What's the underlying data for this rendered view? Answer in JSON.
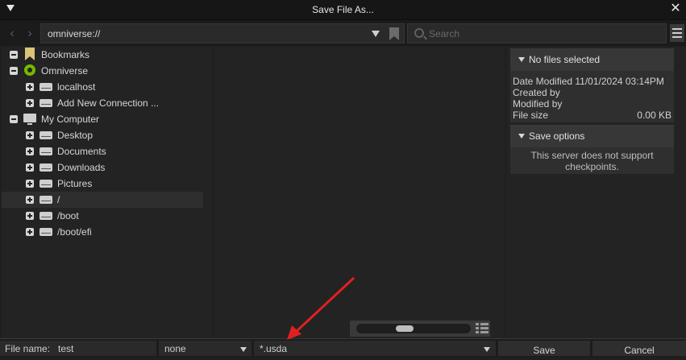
{
  "window": {
    "title": "Save File As..."
  },
  "toolbar": {
    "back_icon": "chevron-left-icon",
    "forward_icon": "chevron-right-icon",
    "path": "omniverse://",
    "search_placeholder": "Search"
  },
  "tree": [
    {
      "label": "Bookmarks",
      "icon": "bookmark-icon",
      "toggle": "minus",
      "level": 0
    },
    {
      "label": "Omniverse",
      "icon": "omniverse-icon",
      "toggle": "minus",
      "level": 0
    },
    {
      "label": "localhost",
      "icon": "server-icon",
      "toggle": "plus",
      "level": 1
    },
    {
      "label": "Add New Connection ...",
      "icon": "add-connection-icon",
      "toggle": "plus",
      "level": 1
    },
    {
      "label": "My Computer",
      "icon": "monitor-icon",
      "toggle": "minus",
      "level": 0
    },
    {
      "label": "Desktop",
      "icon": "drive-icon",
      "toggle": "plus",
      "level": 1
    },
    {
      "label": "Documents",
      "icon": "drive-icon",
      "toggle": "plus",
      "level": 1
    },
    {
      "label": "Downloads",
      "icon": "drive-icon",
      "toggle": "plus",
      "level": 1
    },
    {
      "label": "Pictures",
      "icon": "drive-icon",
      "toggle": "plus",
      "level": 1
    },
    {
      "label": "/",
      "icon": "drive-icon",
      "toggle": "plus",
      "level": 1,
      "selected": true
    },
    {
      "label": "/boot",
      "icon": "drive-icon",
      "toggle": "plus",
      "level": 1
    },
    {
      "label": "/boot/efi",
      "icon": "drive-icon",
      "toggle": "plus",
      "level": 1
    }
  ],
  "details": {
    "header": "No files selected",
    "date_modified": "Date Modified 11/01/2024 03:14PM",
    "created_by": "Created by",
    "modified_by": "Modified by",
    "file_size_label": "File size",
    "file_size_value": "0.00 KB"
  },
  "save_options": {
    "header": "Save options",
    "note_line1": "This server does not support",
    "note_line2": "checkpoints."
  },
  "bottom": {
    "filename_label": "File name:",
    "filename_value": "test",
    "type_value": "none",
    "filter_value": "*.usda",
    "save_label": "Save",
    "cancel_label": "Cancel"
  },
  "annotation": {
    "color": "#e02020"
  }
}
